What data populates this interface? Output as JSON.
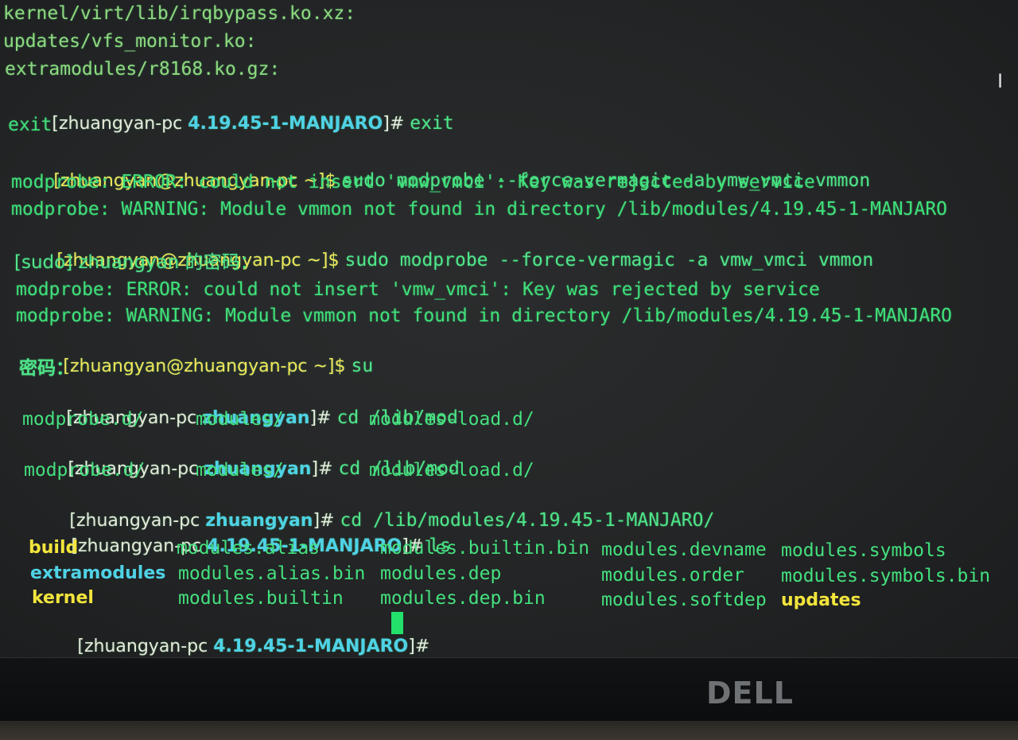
{
  "terminal": {
    "lines": [
      "kernel/virt/lib/irqbypass.ko.xz:",
      "updates/vfs_monitor.ko:",
      "extramodules/r8168.ko.gz:",
      "exit",
      "modprobe: ERROR: could not insert 'vmw_vmci': Key was rejected by service",
      "modprobe: WARNING: Module vmmon not found in directory /lib/modules/4.19.45-1-MANJARO",
      "[sudo] zhuangyan 的密码：",
      "modprobe: ERROR: could not insert 'vmw_vmci': Key was rejected by service",
      "modprobe: WARNING: Module vmmon not found in directory /lib/modules/4.19.45-1-MANJARO",
      "密码："
    ],
    "prompts": {
      "root_manjaro_open": "[zhuangyan-pc ",
      "root_manjaro_host": "4.19.45-1-MANJARO",
      "root_close": "]# ",
      "user": "[zhuangyan@zhuangyan-pc ~]$ ",
      "root_home_host": "zhuangyan"
    },
    "commands": {
      "exit": "exit",
      "modprobe": "sudo modprobe --force-vermagic -a vmw_vmci vmmon",
      "su": "su",
      "cd_partial": "cd /lib/mod",
      "cd_full": "cd /lib/modules/4.19.45-1-MANJARO/",
      "ls": "ls"
    },
    "completion": [
      "modprobe.d/",
      "modules/",
      "modules-load.d/"
    ],
    "ls_output": [
      [
        "build",
        "modules.alias",
        "modules.builtin.bin",
        "modules.devname",
        "modules.symbols"
      ],
      [
        "extramodules",
        "modules.alias.bin",
        "modules.dep",
        "modules.order",
        "modules.symbols.bin"
      ],
      [
        "kernel",
        "modules.builtin",
        "modules.dep.bin",
        "modules.softdep",
        "updates"
      ]
    ]
  },
  "monitor": {
    "brand": "DELL"
  },
  "colors": {
    "green": "#3fe07a",
    "cyan": "#4fd2e6",
    "yellow": "#f2e55a",
    "prompt_white": "#e8e9dc"
  }
}
